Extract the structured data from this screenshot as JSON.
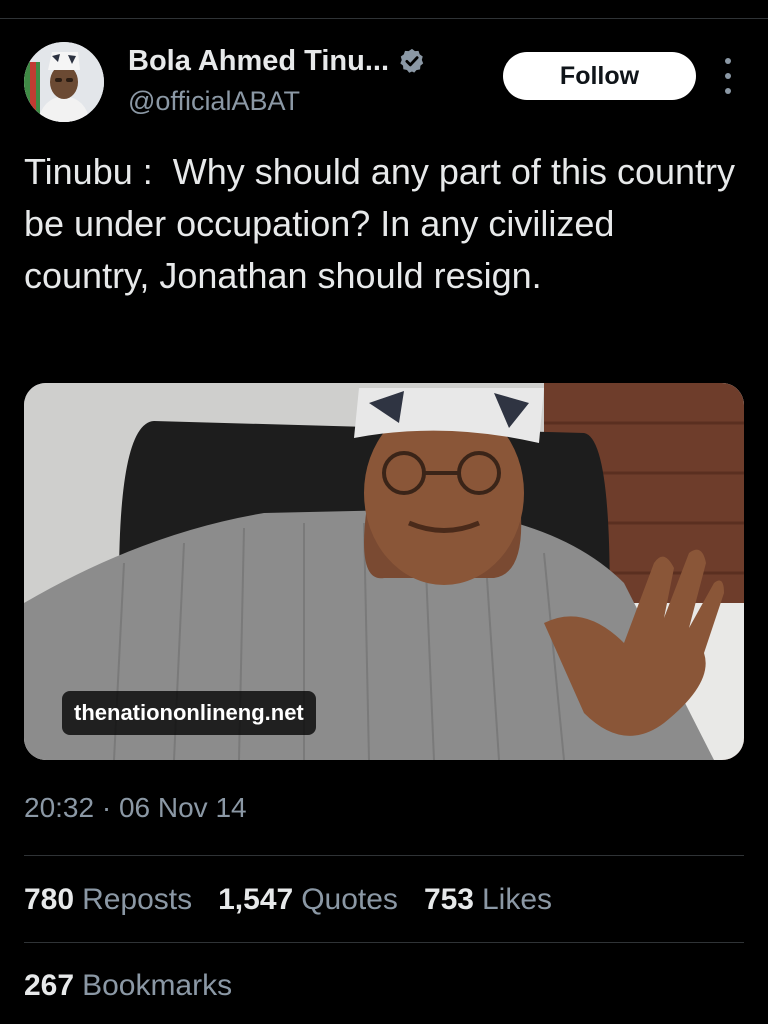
{
  "author": {
    "display_name": "Bola Ahmed Tinu...",
    "handle": "@officialABAT",
    "verified": true
  },
  "actions": {
    "follow_label": "Follow",
    "more_icon": "more-vertical-icon"
  },
  "tweet": {
    "text": "Tinubu :  Why should any part of this country be under occupation? In any civilized country, Jonathan should resign.",
    "media": {
      "source_badge": "thenationonlineng.net"
    },
    "timestamp": "20:32 · 06 Nov 14"
  },
  "stats": {
    "reposts": {
      "count": "780",
      "label": "Reposts"
    },
    "quotes": {
      "count": "1,547",
      "label": "Quotes"
    },
    "likes": {
      "count": "753",
      "label": "Likes"
    },
    "bookmarks": {
      "count": "267",
      "label": "Bookmarks"
    }
  },
  "colors": {
    "background": "#000000",
    "text_primary": "#e7e9ea",
    "text_secondary": "#8b98a5",
    "divider": "#2f3336",
    "verified_badge": "#8b98a5",
    "follow_button_bg": "#ffffff"
  }
}
